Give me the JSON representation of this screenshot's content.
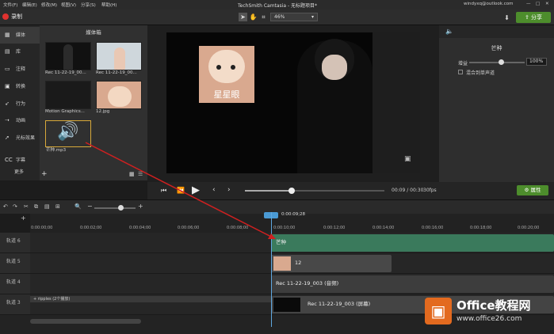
{
  "menu": [
    "文件(F)",
    "编辑(E)",
    "修改(M)",
    "视图(V)",
    "分享(S)",
    "帮助(H)"
  ],
  "title": "TechSmith Camtasia - 无标题项目*",
  "user": "windyxq@outlook.com",
  "record_label": "录制",
  "zoom": "46%",
  "share_label": "分享",
  "sidebar": [
    {
      "label": "媒体",
      "icon": "media-icon"
    },
    {
      "label": "库",
      "icon": "library-icon"
    },
    {
      "label": "注释",
      "icon": "annotation-icon"
    },
    {
      "label": "转换",
      "icon": "transition-icon"
    },
    {
      "label": "行为",
      "icon": "behavior-icon"
    },
    {
      "label": "动画",
      "icon": "animation-icon"
    },
    {
      "label": "光标效果",
      "icon": "cursor-icon"
    },
    {
      "label": "字幕",
      "icon": "caption-icon"
    }
  ],
  "more_label": "更多",
  "bin": {
    "title": "媒体箱",
    "items": [
      "Rec 11-22-19_00...",
      "Rec 11-22-19_00...",
      "Motion Graphics...",
      "12.jpg",
      "芒种.mp3"
    ]
  },
  "canvas": {
    "card_text": "星星眼"
  },
  "props": {
    "title": "芒种",
    "gain_label": "增益",
    "gain_value": "100%",
    "mix_label": "混合到单声道"
  },
  "playback": {
    "time": "00:09 / 00:30",
    "fps": "30fps",
    "props_label": "属性"
  },
  "timeline": {
    "playhead_time": "0:00:09;28",
    "ticks": [
      "0:00:00;00",
      "0:00:02;00",
      "0:00:04;00",
      "0:00:06;00",
      "0:00:08;00",
      "0:00:10;00",
      "0:00:12;00",
      "0:00:14;00",
      "0:00:16;00",
      "0:00:18;00",
      "0:00:20;00"
    ],
    "tracks": [
      {
        "label": "轨道 6",
        "clip": "芒种"
      },
      {
        "label": "轨道 5",
        "clip": "12"
      },
      {
        "label": "轨道 4",
        "clip": "Rec 11-22-19_003 (音频)"
      },
      {
        "label": "轨道 3",
        "clip": "Rec 11-22-19_003 (屏幕)"
      }
    ],
    "ripple": "ripples (2个播放)"
  },
  "watermark": {
    "title": "Office教程网",
    "url": "www.office26.com"
  },
  "colors": {
    "accent": "#4d8d2c",
    "record": "#e0322f",
    "audio_clip": "#3a7a5c",
    "arrow": "#d02020"
  }
}
